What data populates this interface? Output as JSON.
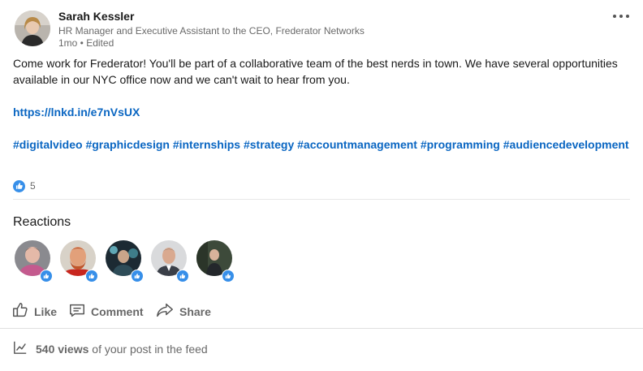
{
  "author": {
    "name": "Sarah Kessler",
    "title": "HR Manager and Executive Assistant to the CEO, Frederator Networks",
    "meta": "1mo • Edited"
  },
  "post": {
    "text": "Come work for Frederator! You'll be part of a collaborative team of the best nerds in town. We have several opportunities available in our NYC office now and we can't wait to hear from you.",
    "link": "https://lnkd.in/e7nVsUX",
    "hashtags": [
      "#digitalvideo",
      "#graphicdesign",
      "#internships",
      "#strategy",
      "#accountmanagement",
      "#programming",
      "#audiencedevelopment"
    ]
  },
  "reactions": {
    "count": "5",
    "title": "Reactions",
    "reactors": [
      {
        "name": "reactor-1"
      },
      {
        "name": "reactor-2"
      },
      {
        "name": "reactor-3"
      },
      {
        "name": "reactor-4"
      },
      {
        "name": "reactor-5"
      }
    ]
  },
  "actions": {
    "like": "Like",
    "comment": "Comment",
    "share": "Share"
  },
  "views": {
    "count": "540 views",
    "suffix": " of your post in the feed"
  },
  "colors": {
    "link": "#0a66c2",
    "like_badge": "#378fe9"
  },
  "icons": {
    "more": "more-horizontal-icon",
    "like": "thumbs-up-icon",
    "comment": "comment-icon",
    "share": "share-icon",
    "views": "trend-chart-icon"
  }
}
